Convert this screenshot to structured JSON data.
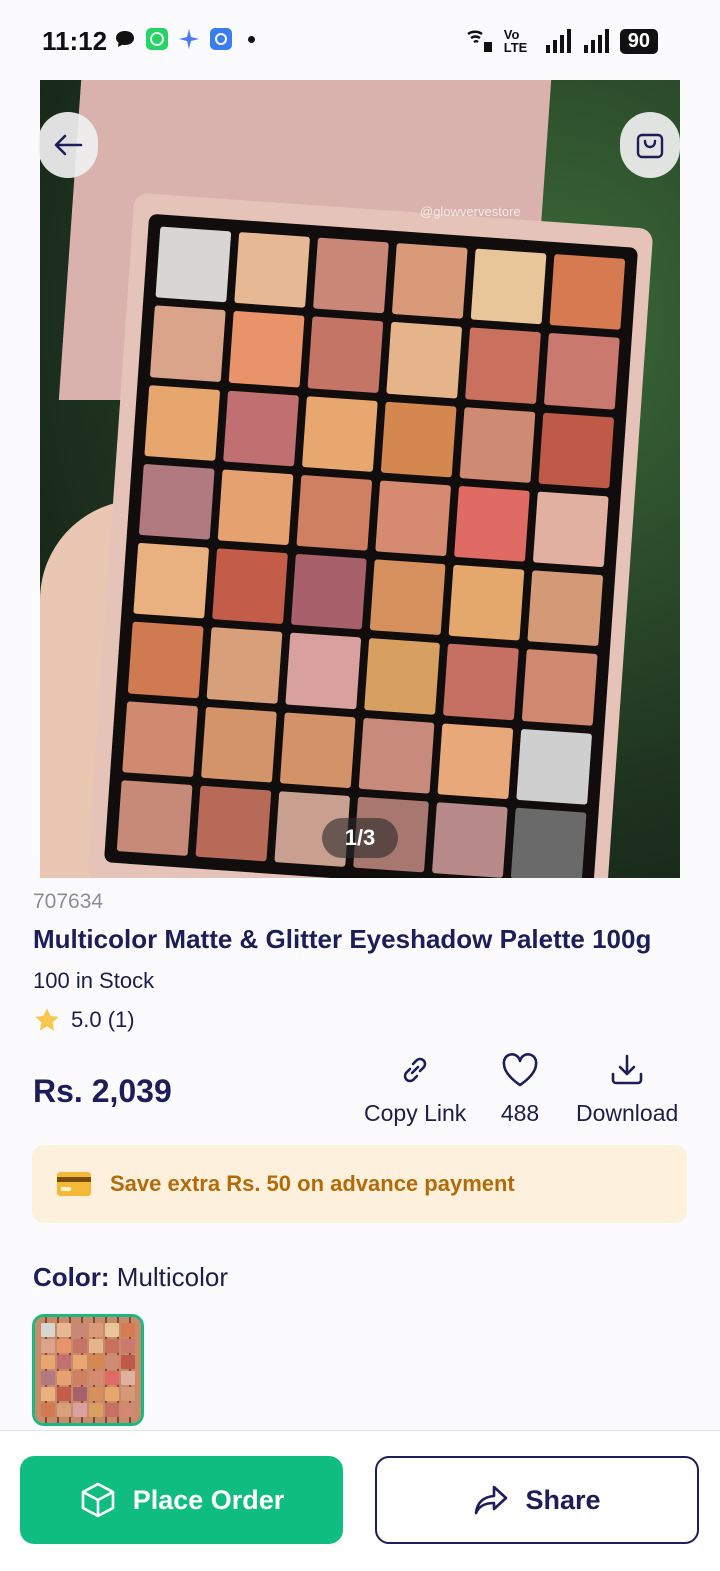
{
  "status_bar": {
    "time": "11:12",
    "network_label": "Vo LTE",
    "battery": "90"
  },
  "hero": {
    "watermark": "@glowvervestore",
    "pager": "1/3"
  },
  "product": {
    "sku": "707634",
    "title": "Multicolor Matte & Glitter Eyeshadow Palette 100g",
    "stock": "100 in Stock",
    "rating": "5.0 (1)",
    "price": "Rs. 2,039"
  },
  "actions": {
    "copy_link": "Copy Link",
    "likes": "488",
    "download": "Download"
  },
  "promo": {
    "text": "Save extra Rs. 50 on advance payment"
  },
  "color": {
    "label": "Color:",
    "value": "Multicolor"
  },
  "buttons": {
    "place_order": "Place Order",
    "share": "Share"
  },
  "colors": {
    "primary_green": "#10bd81",
    "navy": "#1c1d59",
    "promo_bg": "#fdf1dd",
    "promo_text": "#b56a08"
  }
}
